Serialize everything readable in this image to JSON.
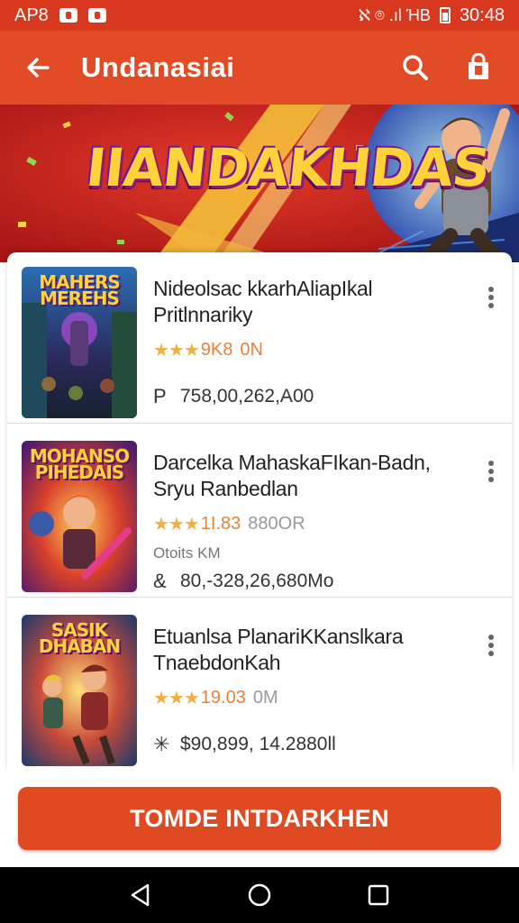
{
  "status_bar": {
    "left_text": "AP8",
    "time": "30:48",
    "right_glyphs": "ℵ ⌾ .ıl ΉΒ"
  },
  "app_bar": {
    "title": "Undanasiai"
  },
  "banner": {
    "title": "IIANDAKHDAS"
  },
  "items": [
    {
      "thumb_title": "MAHERS MEREHS",
      "name": "Nideolsac kkarhAliapIkal Pritlnnariky",
      "stars": "★★★",
      "rating_value": "9K8",
      "rating_extra": "0N",
      "sub": "",
      "price_icon": "Ρ",
      "price": "758,00,262,A00"
    },
    {
      "thumb_title": "MOHANSO PIHEDAIS",
      "name": "Darcelka MahaskaFIkan-Badn, Sryu Ranbedlan",
      "stars": "★★★",
      "rating_value": "1I.83",
      "rating_extra": "880OR",
      "sub": "Otoits KM",
      "price_icon": "&",
      "price": "80,-328,26,680Mo"
    },
    {
      "thumb_title": "SASIK DHABAN",
      "name": "Etuanlsa PlanariKKanslkara TnaebdonKah",
      "stars": "★★★",
      "rating_value": "19.03",
      "rating_extra": "0M",
      "sub": "",
      "price_icon": "✳",
      "price": "$90,899, 14.2880ll"
    }
  ],
  "cta": {
    "label": "TOMDE INTDARKHEN"
  },
  "colors": {
    "brand": "#e14b25",
    "status_bar": "#d8391e",
    "star": "#f0b040"
  }
}
